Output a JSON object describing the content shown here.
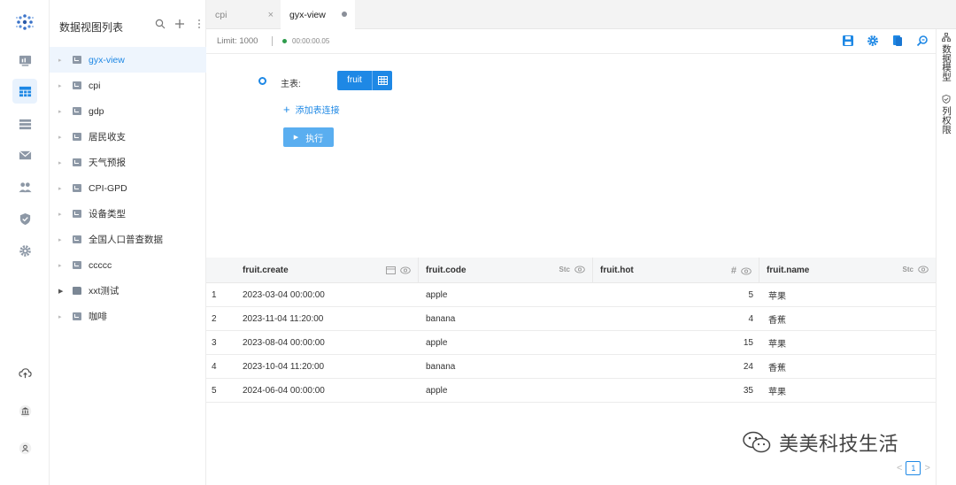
{
  "sidebar_title": "数据视图列表",
  "tree": [
    {
      "label": "gyx-view",
      "active": true
    },
    {
      "label": "cpi"
    },
    {
      "label": "gdp"
    },
    {
      "label": "居民收支"
    },
    {
      "label": "天气预报"
    },
    {
      "label": "CPI-GPD"
    },
    {
      "label": "设备类型"
    },
    {
      "label": "全国人口普查数据"
    },
    {
      "label": "ccccc"
    },
    {
      "label": "xxt测试",
      "folder": true
    },
    {
      "label": "咖啡"
    }
  ],
  "tabs": [
    {
      "label": "cpi",
      "close": "×"
    },
    {
      "label": "gyx-view"
    }
  ],
  "toolbar": {
    "limit": "Limit: 1000",
    "timer": "00:00:00.05"
  },
  "side_panel": {
    "data_model": "数据模型",
    "column_permission": "列权限"
  },
  "editor": {
    "main_table_label": "主表:",
    "main_table": "fruit",
    "add_join": "添加表连接",
    "execute": "执行"
  },
  "table": {
    "columns": [
      {
        "name": "fruit.create"
      },
      {
        "name": "fruit.code",
        "type": "Stc"
      },
      {
        "name": "fruit.hot",
        "type": "#"
      },
      {
        "name": "fruit.name",
        "type": "Stc"
      }
    ],
    "rows": [
      [
        "1",
        "2023-03-04 00:00:00",
        "apple",
        "5",
        "苹果"
      ],
      [
        "2",
        "2023-11-04 11:20:00",
        "banana",
        "4",
        "香蕉"
      ],
      [
        "3",
        "2023-08-04 00:00:00",
        "apple",
        "15",
        "苹果"
      ],
      [
        "4",
        "2023-10-04 11:20:00",
        "banana",
        "24",
        "香蕉"
      ],
      [
        "5",
        "2024-06-04 00:00:00",
        "apple",
        "35",
        "苹果"
      ]
    ]
  },
  "watermark": "美美科技生活",
  "pagination": {
    "current": "1",
    "prev": "<",
    "next": ">"
  }
}
